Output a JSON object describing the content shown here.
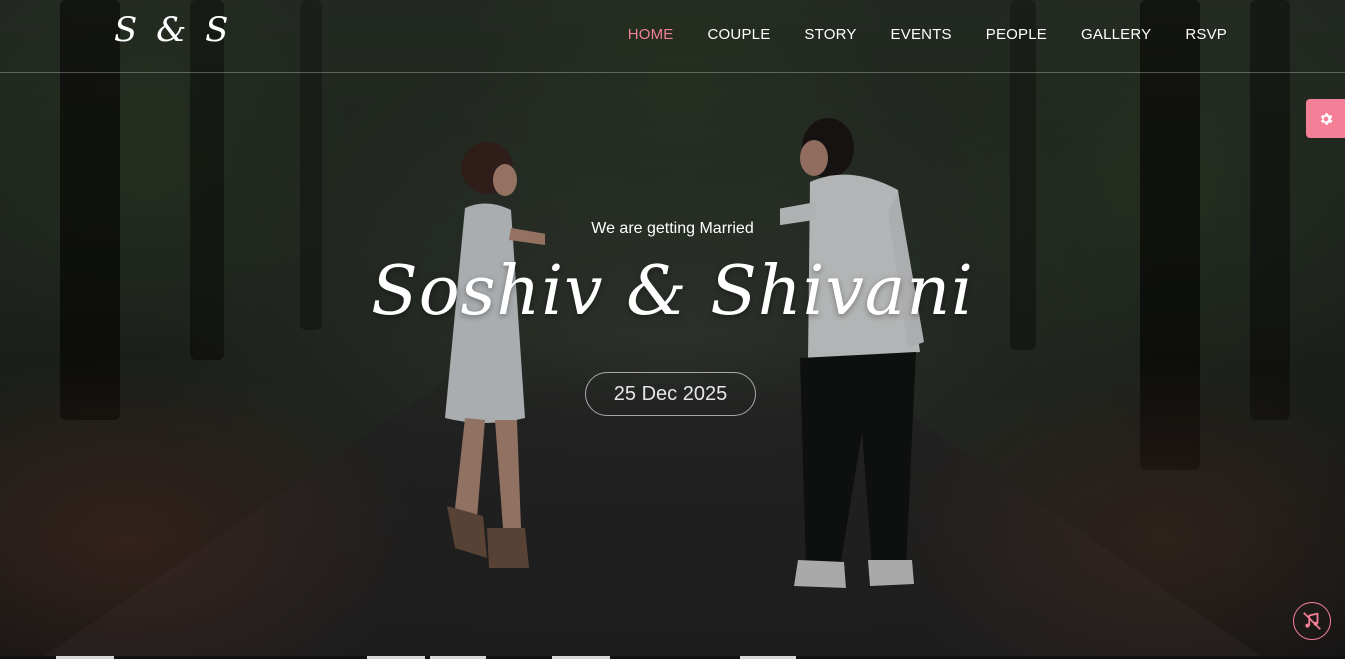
{
  "header": {
    "logo": "S & S",
    "nav": [
      {
        "label": "HOME",
        "active": true
      },
      {
        "label": "COUPLE",
        "active": false
      },
      {
        "label": "STORY",
        "active": false
      },
      {
        "label": "EVENTS",
        "active": false
      },
      {
        "label": "PEOPLE",
        "active": false
      },
      {
        "label": "GALLERY",
        "active": false
      },
      {
        "label": "RSVP",
        "active": false
      }
    ]
  },
  "hero": {
    "intro": "We are getting Married",
    "names": "Soshiv & Shivani",
    "date": "25 Dec 2025"
  },
  "icons": {
    "settings": "gear-icon",
    "music": "music-muted-icon"
  },
  "colors": {
    "accent": "#f47f97",
    "nav_active": "#f07f98",
    "text": "#ffffff"
  }
}
